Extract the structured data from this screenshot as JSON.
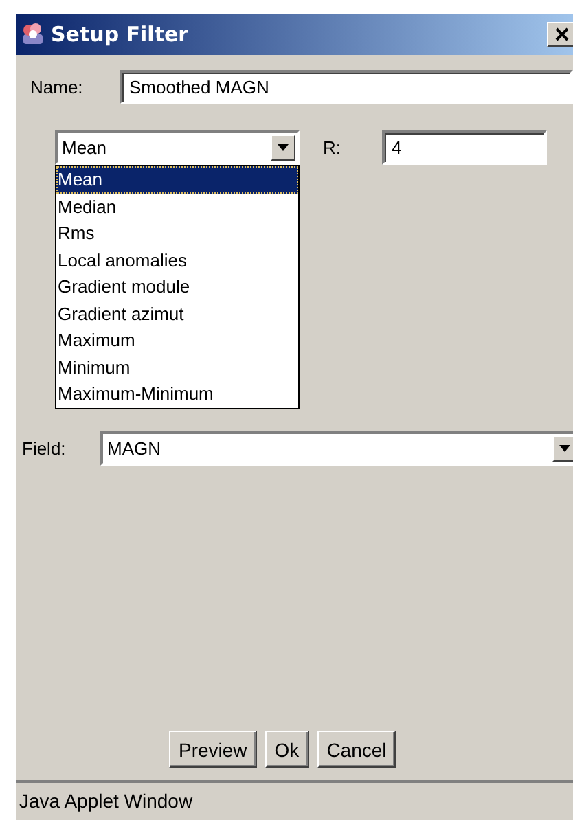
{
  "window": {
    "title": "Setup Filter"
  },
  "name_field": {
    "label": "Name:",
    "value": "Smoothed MAGN"
  },
  "filter_combo": {
    "value": "Mean",
    "expanded": true,
    "options": [
      {
        "label": "Mean",
        "selected": true
      },
      {
        "label": "Median",
        "selected": false
      },
      {
        "label": "Rms",
        "selected": false
      },
      {
        "label": "Local anomalies",
        "selected": false
      },
      {
        "label": "Gradient module",
        "selected": false
      },
      {
        "label": "Gradient azimut",
        "selected": false
      },
      {
        "label": "Maximum",
        "selected": false
      },
      {
        "label": "Minimum",
        "selected": false
      },
      {
        "label": "Maximum-Minimum",
        "selected": false
      }
    ]
  },
  "r_field": {
    "label": "R:",
    "value": "4"
  },
  "field_combo": {
    "label": "Field:",
    "value": "MAGN"
  },
  "buttons": [
    "Preview",
    "Ok",
    "Cancel"
  ],
  "status_bar": "Java Applet Window"
}
